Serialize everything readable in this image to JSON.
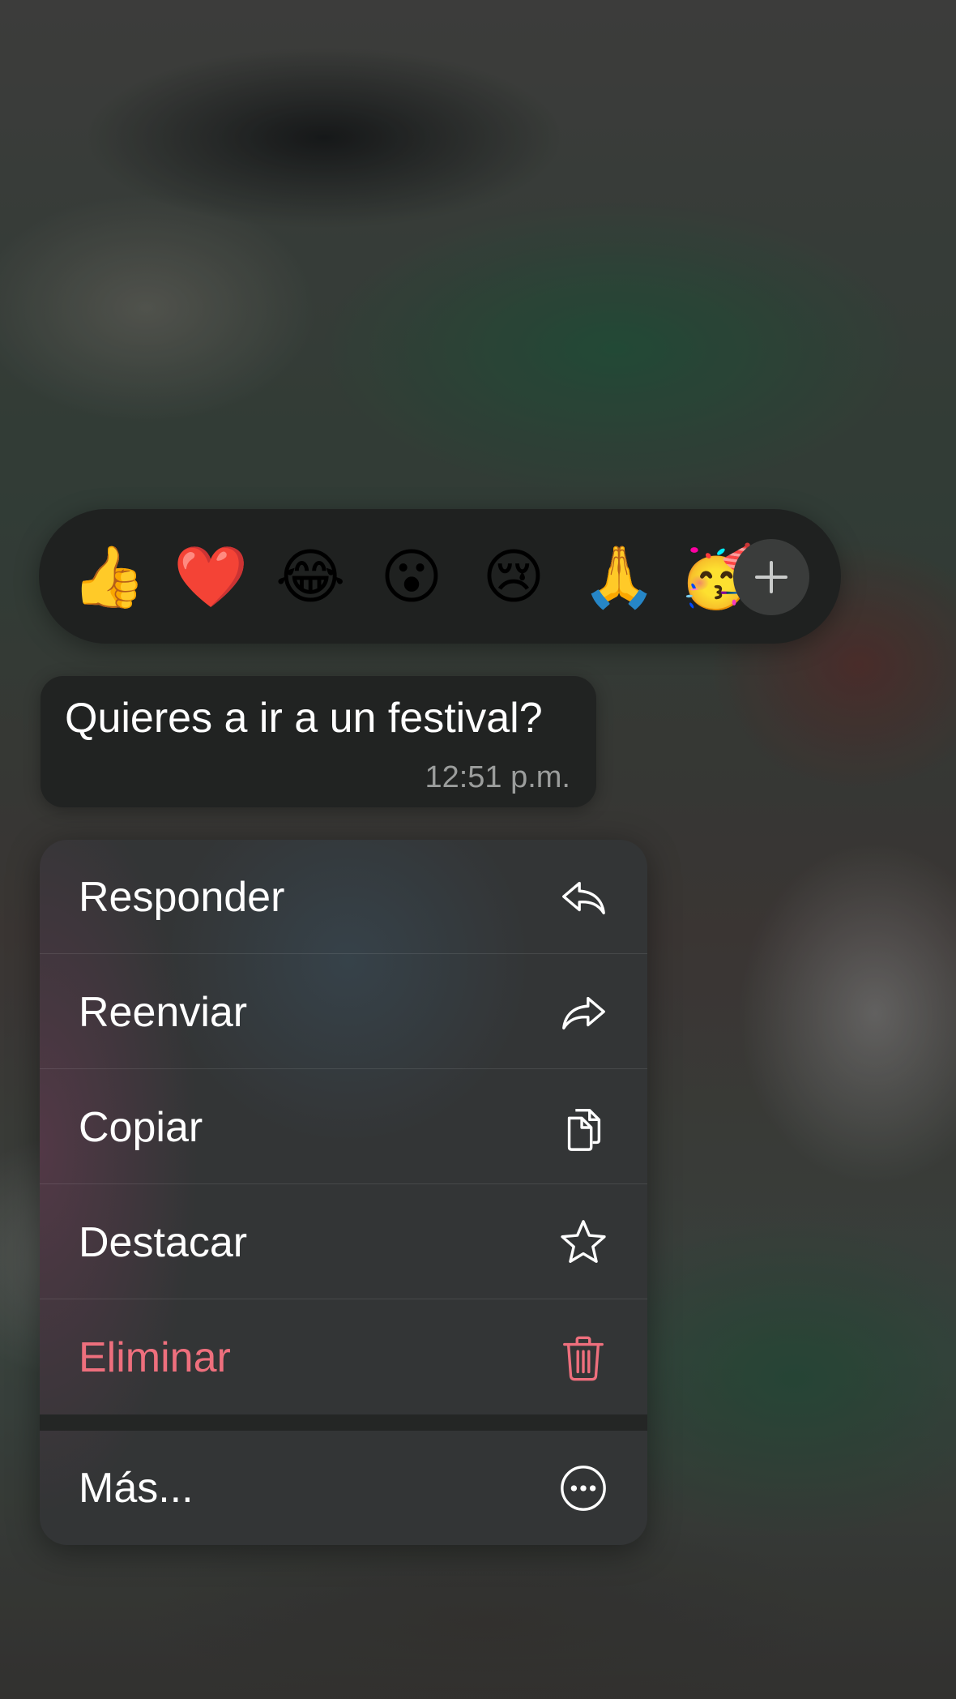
{
  "reactions": {
    "items": [
      {
        "emoji": "👍",
        "name": "thumbs-up"
      },
      {
        "emoji": "❤️",
        "name": "red-heart"
      },
      {
        "emoji": "😂",
        "name": "tears-of-joy"
      },
      {
        "emoji": "😮",
        "name": "surprised"
      },
      {
        "emoji": "😢",
        "name": "crying"
      },
      {
        "emoji": "🙏",
        "name": "folded-hands"
      },
      {
        "emoji": "🥳",
        "name": "partying-face"
      }
    ],
    "more_icon": "plus-icon"
  },
  "message": {
    "text": "Quieres a ir a un festival?",
    "time": "12:51 p.m."
  },
  "menu": {
    "reply": {
      "label": "Responder",
      "icon": "reply-icon"
    },
    "forward": {
      "label": "Reenviar",
      "icon": "forward-icon"
    },
    "copy": {
      "label": "Copiar",
      "icon": "copy-icon"
    },
    "star": {
      "label": "Destacar",
      "icon": "star-icon"
    },
    "delete": {
      "label": "Eliminar",
      "icon": "trash-icon"
    },
    "more": {
      "label": "Más...",
      "icon": "more-icon"
    }
  },
  "colors": {
    "danger": "#ee6f7d",
    "panel": "#333536",
    "bubble": "#212322",
    "timestamp": "#9b9d9c"
  }
}
